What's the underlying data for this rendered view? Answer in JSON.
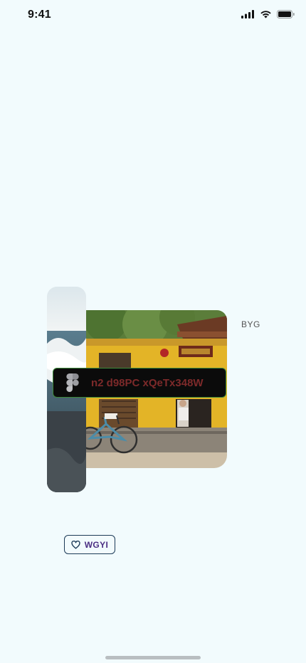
{
  "status_bar": {
    "time": "9:41",
    "icons": [
      "cellular-signal-icon",
      "wifi-icon",
      "battery-icon"
    ]
  },
  "media": {
    "main_photo": "street-with-bicycle-photo",
    "side_photo": "ocean-wave-photo"
  },
  "caption": "BYG",
  "figma_pill": {
    "icon": "figma-icon",
    "text": "n2 d98PC xQeTx348W"
  },
  "like_button": {
    "icon": "heart-icon",
    "label": "WGYI"
  },
  "colors": {
    "background": "#F2FBFD",
    "pill_background": "#0B0B0B",
    "pill_border": "#3D8A3A",
    "pill_text": "#7D2A2A",
    "button_border": "#1C3A57",
    "button_text": "#4B2F83"
  }
}
